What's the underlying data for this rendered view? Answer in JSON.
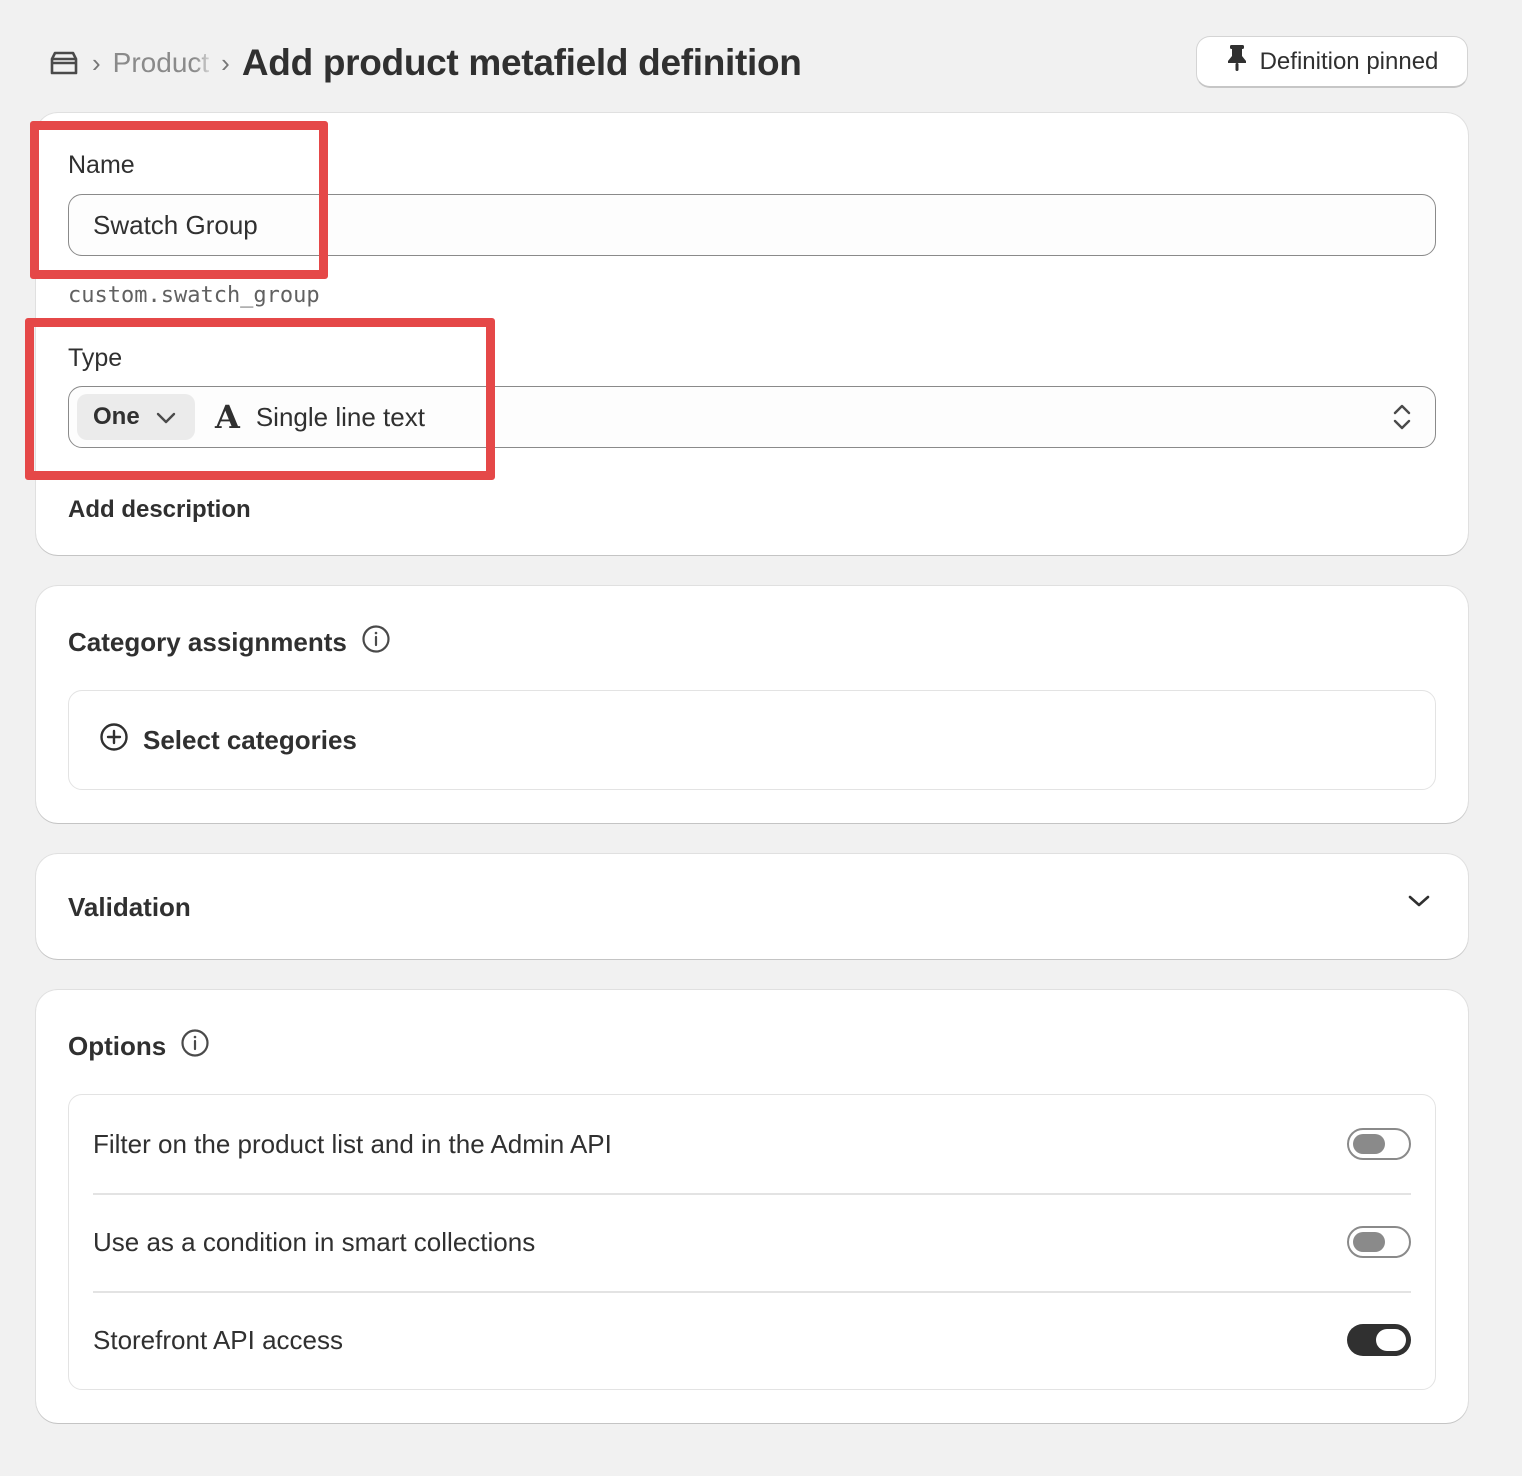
{
  "header": {
    "breadcrumb_parent": "Product",
    "title": "Add product metafield definition",
    "pin_button_label": "Definition pinned"
  },
  "definition": {
    "name_label": "Name",
    "name_value": "Swatch Group",
    "namespace_key": "custom.swatch_group",
    "type_label": "Type",
    "type_cardinality": "One",
    "type_glyph": "A",
    "type_value": "Single line text",
    "add_description_label": "Add description"
  },
  "categories": {
    "title": "Category assignments",
    "select_label": "Select categories"
  },
  "validation": {
    "title": "Validation"
  },
  "options": {
    "title": "Options",
    "rows": [
      {
        "label": "Filter on the product list and in the Admin API",
        "enabled": false
      },
      {
        "label": "Use as a condition in smart collections",
        "enabled": false
      },
      {
        "label": "Storefront API access",
        "enabled": true
      }
    ]
  },
  "colors": {
    "page_bg": "#f1f1f1",
    "highlight": "#e54848",
    "toggle_on": "#303030"
  },
  "icons": [
    "store-icon",
    "pin-icon",
    "chevron-down-icon",
    "updown-chevron-icon",
    "info-icon",
    "plus-circle-icon"
  ]
}
